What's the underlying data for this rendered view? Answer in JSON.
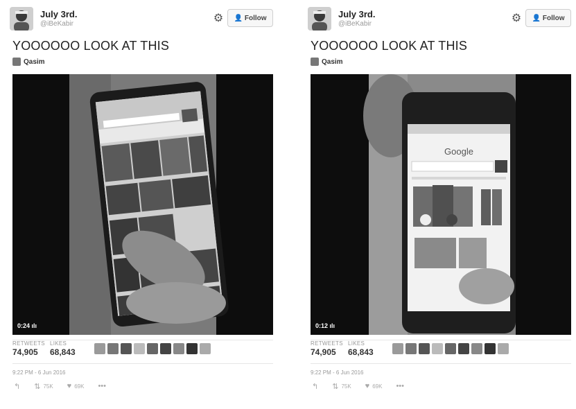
{
  "tweets": [
    {
      "name": "July 3rd.",
      "handle": "@iBeKabir",
      "follow_label": "Follow",
      "text": "YOOOOOO LOOK AT THIS",
      "attribution": "Qasim",
      "video_duration": "0:24",
      "retweets_label": "RETWEETS",
      "retweets": "74,905",
      "likes_label": "LIKES",
      "likes": "68,843",
      "timestamp": "9:22 PM - 6 Jun 2016",
      "action_retweets": "75K",
      "action_likes": "69K",
      "icons": [
        "reply-icon",
        "retweet-icon",
        "heart-icon",
        "more-icon",
        "gear-icon",
        "follow-user-icon"
      ]
    },
    {
      "name": "July 3rd.",
      "handle": "@iBeKabir",
      "follow_label": "Follow",
      "text": "YOOOOOO LOOK AT THIS",
      "attribution": "Qasim",
      "video_duration": "0:12",
      "retweets_label": "RETWEETS",
      "retweets": "74,905",
      "likes_label": "LIKES",
      "likes": "68,843",
      "timestamp": "9:22 PM - 6 Jun 2016",
      "action_retweets": "75K",
      "action_likes": "69K",
      "video_google_logo": "Google",
      "icons": [
        "reply-icon",
        "retweet-icon",
        "heart-icon",
        "more-icon",
        "gear-icon",
        "follow-user-icon"
      ]
    }
  ]
}
